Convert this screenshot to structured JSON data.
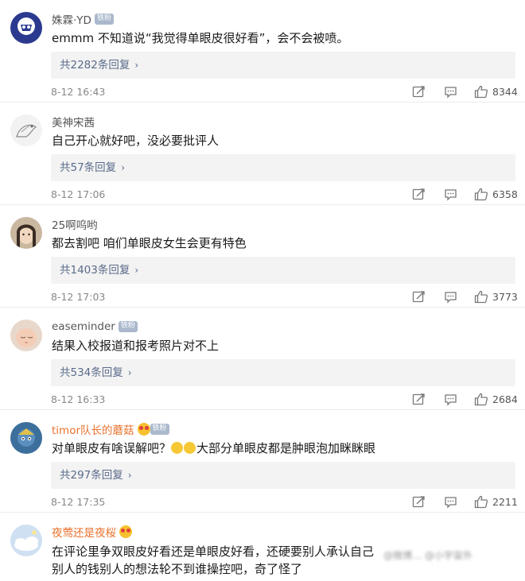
{
  "comments": [
    {
      "username": "姝霖·YD",
      "badge": "铁粉",
      "text": "emmm  不知道说“我觉得单眼皮很好看”，会不会被喷。",
      "replies": "共2282条回复",
      "time": "8-12 16:43",
      "likes": "8344"
    },
    {
      "username": "美神宋茜",
      "text": "自己开心就好吧，没必要批评人",
      "replies": "共57条回复",
      "time": "8-12 17:06",
      "likes": "6358"
    },
    {
      "username": "25啊呜哟",
      "text": "都去割吧 咱们单眼皮女生会更有特色",
      "replies": "共1403条回复",
      "time": "8-12 17:03",
      "likes": "3773"
    },
    {
      "username": "easeminder",
      "badge": "铁粉",
      "text": "结果入校报道和报考照片对不上",
      "replies": "共534条回复",
      "time": "8-12 16:33",
      "likes": "2684"
    },
    {
      "username": "timor队长的蘑菇",
      "badge": "铁粉",
      "text_before": "对单眼皮有啥误解吧？",
      "text_after": "大部分单眼皮都是肿眼泡加眯眯眼",
      "replies": "共297条回复",
      "time": "8-12 17:35",
      "likes": "2211"
    },
    {
      "username": "夜莺还是夜桜",
      "text_line1": "在评论里争双眼皮好看还是单眼皮好看，还硬要别人承认自己",
      "text_line2": "别人的钱别人的想法轮不到谁操控吧，奇了怪了"
    }
  ],
  "watermark": "@微博…  @小宇宙外",
  "colors": {
    "accent_name": "#e8712d",
    "reply_link": "#5a6b8a",
    "badge_bg": "#aab8cc"
  }
}
